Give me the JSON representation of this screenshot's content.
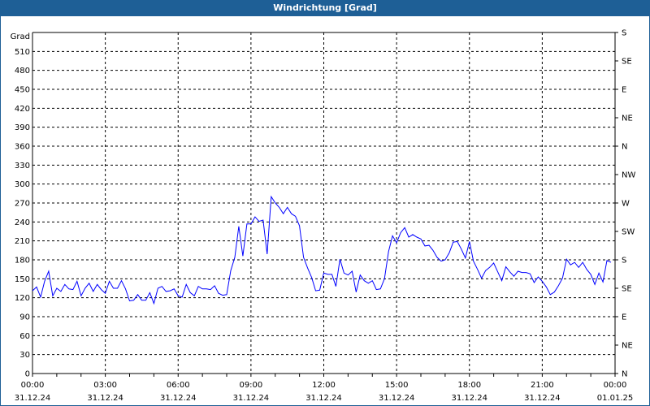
{
  "title": "Windrichtung [Grad]",
  "chart_data": {
    "type": "line",
    "title": "Windrichtung [Grad]",
    "ylabel": "Grad",
    "ylim": [
      0,
      540
    ],
    "yticks": [
      0,
      30,
      60,
      90,
      120,
      150,
      180,
      210,
      240,
      270,
      300,
      330,
      360,
      390,
      420,
      450,
      480,
      510
    ],
    "y2ticks": [
      {
        "value": 0,
        "label": "N"
      },
      {
        "value": 45,
        "label": "NE"
      },
      {
        "value": 90,
        "label": "E"
      },
      {
        "value": 135,
        "label": "SE"
      },
      {
        "value": 180,
        "label": "S"
      },
      {
        "value": 225,
        "label": "SW"
      },
      {
        "value": 270,
        "label": "W"
      },
      {
        "value": 315,
        "label": "NW"
      },
      {
        "value": 360,
        "label": "N"
      },
      {
        "value": 405,
        "label": "NE"
      },
      {
        "value": 450,
        "label": "E"
      },
      {
        "value": 495,
        "label": "SE"
      },
      {
        "value": 540,
        "label": "S"
      }
    ],
    "xlim_hours": [
      0,
      24
    ],
    "xticks": [
      {
        "hour": 0,
        "time": "00:00",
        "date": "31.12.24"
      },
      {
        "hour": 3,
        "time": "03:00",
        "date": "31.12.24"
      },
      {
        "hour": 6,
        "time": "06:00",
        "date": "31.12.24"
      },
      {
        "hour": 9,
        "time": "09:00",
        "date": "31.12.24"
      },
      {
        "hour": 12,
        "time": "12:00",
        "date": "31.12.24"
      },
      {
        "hour": 15,
        "time": "15:00",
        "date": "31.12.24"
      },
      {
        "hour": 18,
        "time": "18:00",
        "date": "31.12.24"
      },
      {
        "hour": 21,
        "time": "21:00",
        "date": "31.12.24"
      },
      {
        "hour": 24,
        "time": "00:00",
        "date": "01.01.25"
      }
    ],
    "grid": true,
    "series": [
      {
        "name": "Windrichtung",
        "color": "#0000ff",
        "start_hour": 0,
        "interval_minutes": 10,
        "values": [
          131,
          137,
          121,
          146,
          162,
          123,
          135,
          130,
          141,
          134,
          133,
          146,
          123,
          135,
          143,
          130,
          141,
          133,
          127,
          146,
          135,
          135,
          147,
          134,
          115,
          116,
          125,
          116,
          116,
          128,
          111,
          135,
          138,
          130,
          131,
          134,
          123,
          121,
          141,
          128,
          123,
          138,
          134,
          134,
          133,
          139,
          127,
          124,
          125,
          163,
          184,
          233,
          186,
          237,
          237,
          248,
          241,
          243,
          189,
          280,
          270,
          263,
          253,
          263,
          253,
          249,
          234,
          184,
          167,
          152,
          131,
          132,
          159,
          157,
          157,
          138,
          181,
          159,
          156,
          162,
          129,
          156,
          147,
          143,
          147,
          133,
          134,
          150,
          193,
          218,
          207,
          223,
          231,
          216,
          220,
          216,
          213,
          202,
          203,
          195,
          184,
          178,
          180,
          191,
          208,
          209,
          197,
          183,
          209,
          178,
          165,
          151,
          163,
          168,
          175,
          161,
          147,
          169,
          161,
          154,
          162,
          160,
          160,
          158,
          144,
          153,
          146,
          137,
          125,
          129,
          139,
          151,
          181,
          172,
          176,
          168,
          176,
          165,
          157,
          141,
          159,
          145,
          179,
          176
        ]
      }
    ]
  }
}
